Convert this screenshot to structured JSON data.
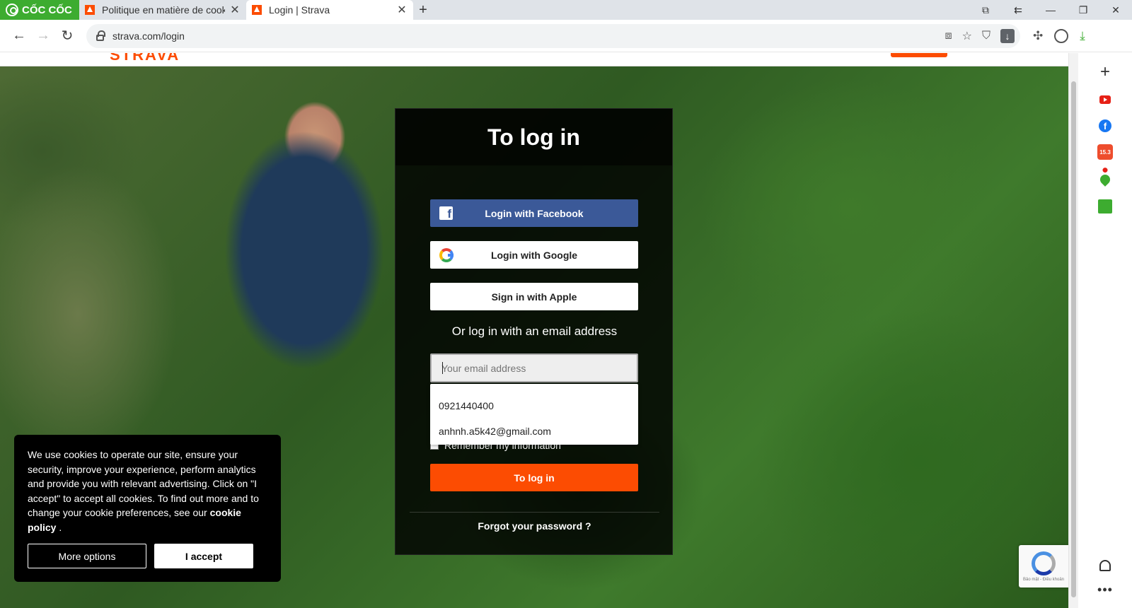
{
  "browser": {
    "brand": "CỐC CỐC",
    "tabs": [
      {
        "title": "Politique en matière de cookies",
        "active": false
      },
      {
        "title": "Login | Strava",
        "active": true
      }
    ],
    "address": "strava.com/login",
    "accent_color": "#3dac30"
  },
  "login": {
    "title": "To log in",
    "facebook_label": "Login with Facebook",
    "google_label": "Login with Google",
    "apple_label": "Sign in with Apple",
    "or_text": "Or log in with an email address",
    "email_placeholder": "Your email address",
    "autocomplete": [
      "0921440400",
      "anhnh.a5k42@gmail.com"
    ],
    "remember_label": "Remember my information",
    "submit_label": "To log in",
    "forgot_label": "Forgot your password ?",
    "brand_color": "#fc4c02",
    "facebook_color": "#3b5998"
  },
  "cookie_banner": {
    "text": "We use cookies to operate our site, ensure your security, improve your experience, perform analytics and provide you with relevant advertising. Click on \"I accept\" to accept all cookies. To find out more and to change your cookie preferences, see our",
    "policy_link": "cookie policy",
    "text_end": " .",
    "more_options": "More options",
    "accept": "I accept"
  },
  "sidebar": {
    "icons": [
      "plus-icon",
      "youtube-icon",
      "facebook-icon",
      "shopee-icon",
      "map-pin-icon",
      "sheet-icon",
      "bell-icon",
      "more-icon"
    ],
    "shop_badge": "15.3"
  }
}
